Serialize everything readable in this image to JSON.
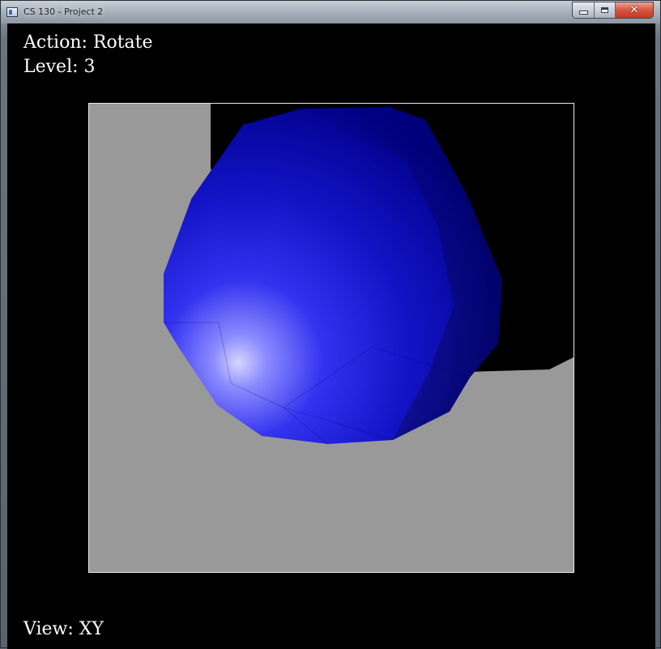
{
  "window": {
    "title": "CS 130 - Project 2",
    "buttons": {
      "minimize": "minimize",
      "maximize": "maximize",
      "close": "✕"
    }
  },
  "hud": {
    "action": "Action: Rotate",
    "level": "Level: 3",
    "view": "View: XY"
  },
  "scene": {
    "background_color": "#000000",
    "floor_color": "#999999",
    "sphere_color": "#1a1aff",
    "highlight_color": "#c8c8ff",
    "frame_color": "#e8e8e8"
  }
}
